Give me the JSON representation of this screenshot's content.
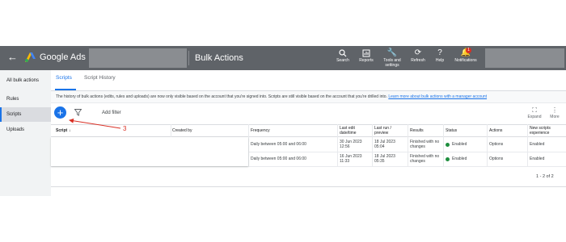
{
  "header": {
    "back_icon": "arrow-left-icon",
    "logo_icon": "google-ads-logo",
    "app_title": "Google Ads",
    "page_title": "Bulk Actions",
    "actions": [
      {
        "label": "Search",
        "icon": "search-icon"
      },
      {
        "label": "Reports",
        "icon": "reports-icon"
      },
      {
        "label": "Tools and settings",
        "icon": "tools-icon"
      },
      {
        "label": "Refresh",
        "icon": "refresh-icon"
      },
      {
        "label": "Help",
        "icon": "help-icon"
      },
      {
        "label": "Notifications",
        "icon": "bell-icon",
        "badge": "1"
      }
    ]
  },
  "sidebar": {
    "items": [
      {
        "label": "All bulk actions",
        "active": false
      },
      {
        "label": "Rules",
        "active": false
      },
      {
        "label": "Scripts",
        "active": true
      },
      {
        "label": "Uploads",
        "active": false
      }
    ]
  },
  "tabs": [
    {
      "label": "Scripts",
      "active": true
    },
    {
      "label": "Script History",
      "active": false
    }
  ],
  "notice": {
    "text": "The history of bulk actions (edits, rules and uploads) are now only visible based on the account that you're signed into. Scripts are still visible based on the account that you're drilled into.",
    "link": "Learn more about bulk actions with a manager account"
  },
  "toolbar": {
    "add_icon": "plus-icon",
    "filter_icon": "filter-icon",
    "add_filter": "Add filter",
    "expand_label": "Expand",
    "more_label": "More"
  },
  "annotation": {
    "label": "3"
  },
  "table": {
    "columns": [
      "Script",
      "Created by",
      "Frequency",
      "Last edit date/time",
      "Last run / preview",
      "Results",
      "Status",
      "Actions",
      "New scripts experience"
    ],
    "sort_icon": "arrow-down-icon",
    "rows": [
      {
        "frequency": "Daily between 05:00 and 06:00",
        "last_edit": "30 Jun 2023 12:56",
        "last_run": "18 Jul 2023 05:04",
        "results": "Finished with no changes",
        "status": "Enabled",
        "actions": "Options",
        "experience": "Enabled"
      },
      {
        "frequency": "Daily between 05:00 and 06:00",
        "last_edit": "16 Jun 2023 11:33",
        "last_run": "18 Jul 2023 05:35",
        "results": "Finished with no changes",
        "status": "Enabled",
        "actions": "Options",
        "experience": "Enabled"
      }
    ],
    "pagination": "1 - 2 of 2"
  },
  "colors": {
    "header_bg": "#5f6368",
    "accent": "#1a73e8",
    "status_enabled": "#1e8e3e",
    "annotation": "#d93025"
  }
}
